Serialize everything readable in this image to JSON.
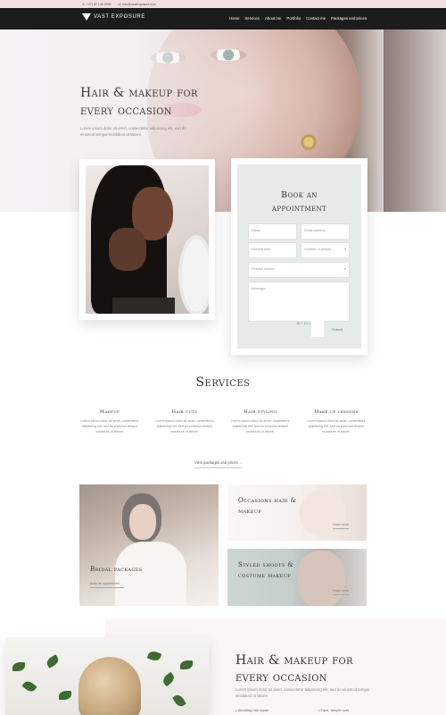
{
  "topbar": {
    "phone": "+27) 87 135 2996",
    "email": "info@vastexposure.com",
    "phone_icon": "phone-icon",
    "email_icon": "envelope-icon"
  },
  "nav": {
    "logo_text": "VAST EXPOSURE",
    "items": [
      "Home",
      "Services",
      "About me",
      "Portfolio",
      "Contact me",
      "Packages and prices"
    ]
  },
  "hero": {
    "title_line1": "Hair & makeup for",
    "title_line2": "every occasion",
    "text": "Lorem ipsum dolor sit amet, consectetur adipiscing elit, sed do eiusmod tempor incididunt ut labore."
  },
  "booking": {
    "title_line1": "Book an",
    "title_line2": "appointment",
    "name_placeholder": "Name",
    "email_placeholder": "Email address",
    "date_placeholder": "Desired date",
    "people_placeholder": "Number of people",
    "service_placeholder": "Desired service",
    "message_placeholder": "Message",
    "captcha": "10 + 10 =",
    "submit": "Submit"
  },
  "services": {
    "title": "Services",
    "items": [
      {
        "title": "Makeup",
        "text": "Lorem ipsum dolor sit amet, consectetur adipiscing elit, sed do eiusmod tempor incididunt ut labore."
      },
      {
        "title": "Hair cuts",
        "text": "Lorem ipsum dolor sit amet, consectetur adipiscing elit, sed do eiusmod tempor incididunt ut labore."
      },
      {
        "title": "Hair styling",
        "text": "Lorem ipsum dolor sit amet, consectetur adipiscing elit, sed do eiusmod tempor incididunt ut labore."
      },
      {
        "title": "Make up lessons",
        "text": "Lorem ipsum dolor sit amet, consectetur adipiscing elit, sed do eiusmod tempor incididunt ut labore."
      }
    ],
    "link": "View packages and prices →"
  },
  "tiles": {
    "bridal": {
      "title": "Bridal packages",
      "button": "Book an appointment →"
    },
    "occasions": {
      "title_line1": "Occasions hair &",
      "title_line2": "makeup",
      "button": "Learn more"
    },
    "styled": {
      "title_line1": "Styled shoots &",
      "title_line2": "costume makeup",
      "button": "Learn more"
    }
  },
  "bottom": {
    "title_line1": "Hair & makeup for",
    "title_line2": "every occasion",
    "text": "Lorem ipsum dolor sit amet, consectetur adipiscing elit, sed do eiusmod tempor incididunt ut labore.",
    "bullet1": "Wedding hair repair",
    "bullet2": "Face, temple cuts"
  }
}
